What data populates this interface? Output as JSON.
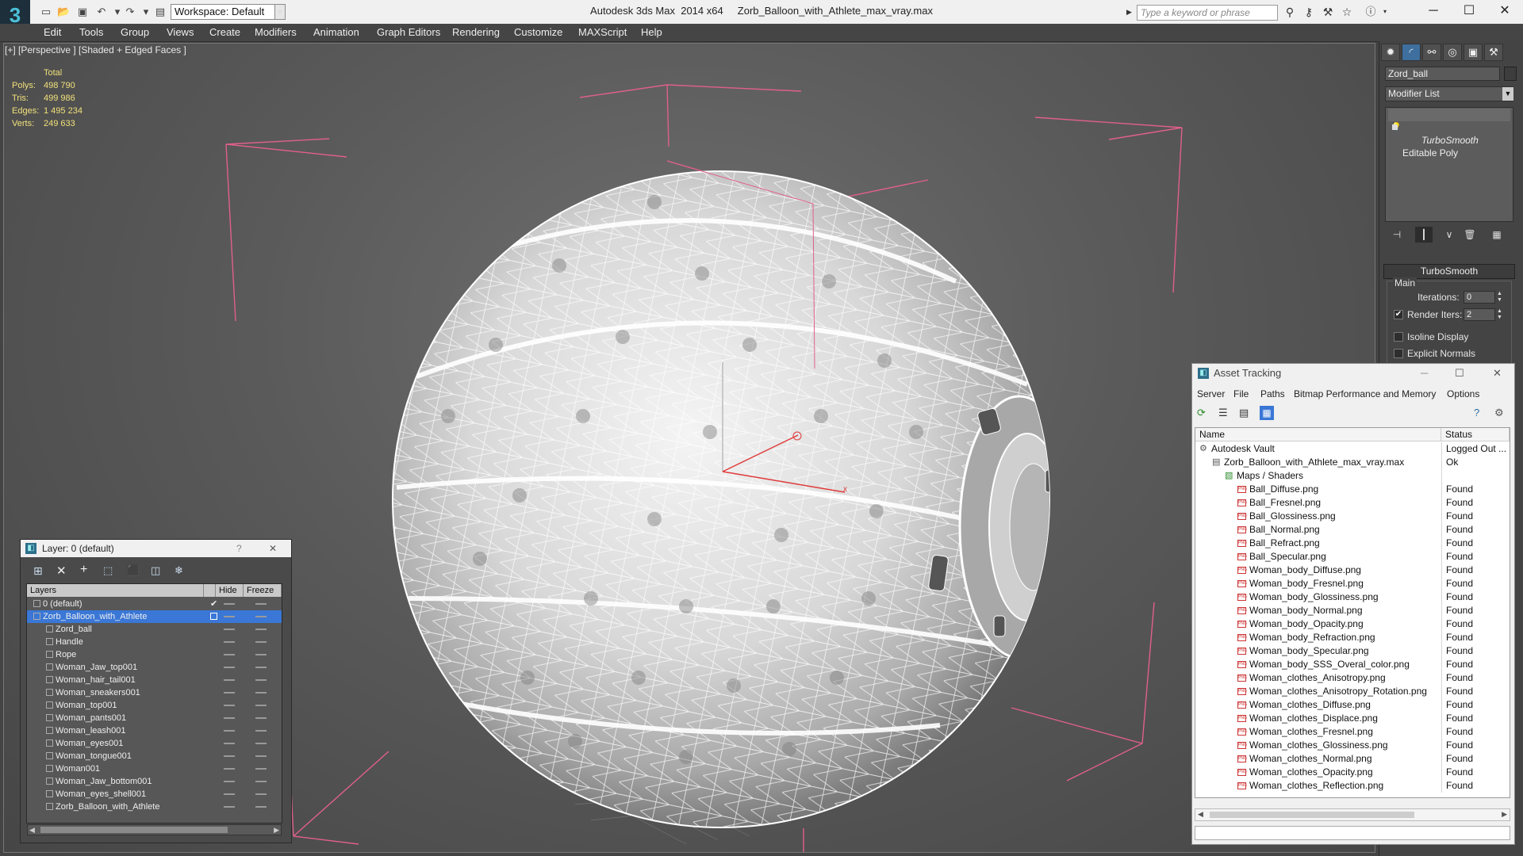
{
  "window": {
    "app_title": "Autodesk 3ds Max  2014 x64",
    "file_title": "Zorb_Balloon_with_Athlete_max_vray.max",
    "workspace": "Workspace: Default",
    "search_placeholder": "Type a keyword or phrase",
    "logo": "3",
    "minimize": "─",
    "maximize": "☐",
    "close": "✕"
  },
  "menu": [
    "Edit",
    "Tools",
    "Group",
    "Views",
    "Create",
    "Modifiers",
    "Animation",
    "Graph Editors",
    "Rendering",
    "Customize",
    "MAXScript",
    "Help"
  ],
  "viewport": {
    "label": "[+] [Perspective ] [Shaded + Edged Faces ]",
    "stats": {
      "header": "Total",
      "rows": [
        {
          "label": "Polys:",
          "value": "498 790"
        },
        {
          "label": "Tris:",
          "value": "499 986"
        },
        {
          "label": "Edges:",
          "value": "1 495 234"
        },
        {
          "label": "Verts:",
          "value": "249 633"
        }
      ]
    },
    "axis_labels": {
      "z": "z",
      "x": "x"
    }
  },
  "command_panel": {
    "object_name": "Zord_ball",
    "modifier_list": "Modifier List",
    "stack": [
      {
        "label": "TurboSmooth",
        "italic": true
      },
      {
        "label": "Editable Poly",
        "italic": false
      }
    ],
    "rollout_title": "TurboSmooth",
    "group_title": "Main",
    "iterations_label": "Iterations:",
    "iterations_value": "0",
    "render_iters_label": "Render Iters:",
    "render_iters_value": "2",
    "render_iters_checked": "✔",
    "isoline_label": "Isoline Display",
    "explicit_normals_label": "Explicit Normals"
  },
  "layer_dialog": {
    "title": "Layer: 0 (default)",
    "help": "?",
    "close": "✕",
    "col_layers": "Layers",
    "col_hide": "Hide",
    "col_freeze": "Freeze",
    "rows": [
      {
        "name": "0 (default)",
        "indent": 0,
        "type": "layer",
        "check": "✔"
      },
      {
        "name": "Zorb_Balloon_with_Athlete",
        "indent": 0,
        "type": "layer",
        "selected": true
      },
      {
        "name": "Zord_ball",
        "indent": 1,
        "type": "object"
      },
      {
        "name": "Handle",
        "indent": 1,
        "type": "object"
      },
      {
        "name": "Rope",
        "indent": 1,
        "type": "object"
      },
      {
        "name": "Woman_Jaw_top001",
        "indent": 1,
        "type": "object"
      },
      {
        "name": "Woman_hair_tail001",
        "indent": 1,
        "type": "object"
      },
      {
        "name": "Woman_sneakers001",
        "indent": 1,
        "type": "object"
      },
      {
        "name": "Woman_top001",
        "indent": 1,
        "type": "object"
      },
      {
        "name": "Woman_pants001",
        "indent": 1,
        "type": "object"
      },
      {
        "name": "Woman_leash001",
        "indent": 1,
        "type": "object"
      },
      {
        "name": "Woman_eyes001",
        "indent": 1,
        "type": "object"
      },
      {
        "name": "Woman_tongue001",
        "indent": 1,
        "type": "object"
      },
      {
        "name": "Woman001",
        "indent": 1,
        "type": "object"
      },
      {
        "name": "Woman_Jaw_bottom001",
        "indent": 1,
        "type": "object"
      },
      {
        "name": "Woman_eyes_shell001",
        "indent": 1,
        "type": "object"
      },
      {
        "name": "Zorb_Balloon_with_Athlete",
        "indent": 1,
        "type": "object"
      }
    ]
  },
  "asset_tracking": {
    "title": "Asset Tracking",
    "menu": [
      "Server",
      "File",
      "Paths",
      "Bitmap Performance and Memory",
      "Options"
    ],
    "col_name": "Name",
    "col_status": "Status",
    "rows": [
      {
        "name": "Autodesk Vault",
        "status": "Logged Out ...",
        "indent": 0,
        "type": "vault"
      },
      {
        "name": "Zorb_Balloon_with_Athlete_max_vray.max",
        "status": "Ok",
        "indent": 1,
        "type": "max"
      },
      {
        "name": "Maps / Shaders",
        "status": "",
        "indent": 2,
        "type": "maps"
      },
      {
        "name": "Ball_Diffuse.png",
        "status": "Found",
        "indent": 3,
        "type": "png"
      },
      {
        "name": "Ball_Fresnel.png",
        "status": "Found",
        "indent": 3,
        "type": "png"
      },
      {
        "name": "Ball_Glossiness.png",
        "status": "Found",
        "indent": 3,
        "type": "png"
      },
      {
        "name": "Ball_Normal.png",
        "status": "Found",
        "indent": 3,
        "type": "png"
      },
      {
        "name": "Ball_Refract.png",
        "status": "Found",
        "indent": 3,
        "type": "png"
      },
      {
        "name": "Ball_Specular.png",
        "status": "Found",
        "indent": 3,
        "type": "png"
      },
      {
        "name": "Woman_body_Diffuse.png",
        "status": "Found",
        "indent": 3,
        "type": "png"
      },
      {
        "name": "Woman_body_Fresnel.png",
        "status": "Found",
        "indent": 3,
        "type": "png"
      },
      {
        "name": "Woman_body_Glossiness.png",
        "status": "Found",
        "indent": 3,
        "type": "png"
      },
      {
        "name": "Woman_body_Normal.png",
        "status": "Found",
        "indent": 3,
        "type": "png"
      },
      {
        "name": "Woman_body_Opacity.png",
        "status": "Found",
        "indent": 3,
        "type": "png"
      },
      {
        "name": "Woman_body_Refraction.png",
        "status": "Found",
        "indent": 3,
        "type": "png"
      },
      {
        "name": "Woman_body_Specular.png",
        "status": "Found",
        "indent": 3,
        "type": "png"
      },
      {
        "name": "Woman_body_SSS_Overal_color.png",
        "status": "Found",
        "indent": 3,
        "type": "png"
      },
      {
        "name": "Woman_clothes_Anisotropy.png",
        "status": "Found",
        "indent": 3,
        "type": "png"
      },
      {
        "name": "Woman_clothes_Anisotropy_Rotation.png",
        "status": "Found",
        "indent": 3,
        "type": "png"
      },
      {
        "name": "Woman_clothes_Diffuse.png",
        "status": "Found",
        "indent": 3,
        "type": "png"
      },
      {
        "name": "Woman_clothes_Displace.png",
        "status": "Found",
        "indent": 3,
        "type": "png"
      },
      {
        "name": "Woman_clothes_Fresnel.png",
        "status": "Found",
        "indent": 3,
        "type": "png"
      },
      {
        "name": "Woman_clothes_Glossiness.png",
        "status": "Found",
        "indent": 3,
        "type": "png"
      },
      {
        "name": "Woman_clothes_Normal.png",
        "status": "Found",
        "indent": 3,
        "type": "png"
      },
      {
        "name": "Woman_clothes_Opacity.png",
        "status": "Found",
        "indent": 3,
        "type": "png"
      },
      {
        "name": "Woman_clothes_Reflection.png",
        "status": "Found",
        "indent": 3,
        "type": "png"
      }
    ]
  },
  "colors": {
    "stats_text": "#f1e07a",
    "selection": "#3a77d6",
    "bbox_lines": "#e0608a",
    "axis_x": "#e03a3a"
  }
}
